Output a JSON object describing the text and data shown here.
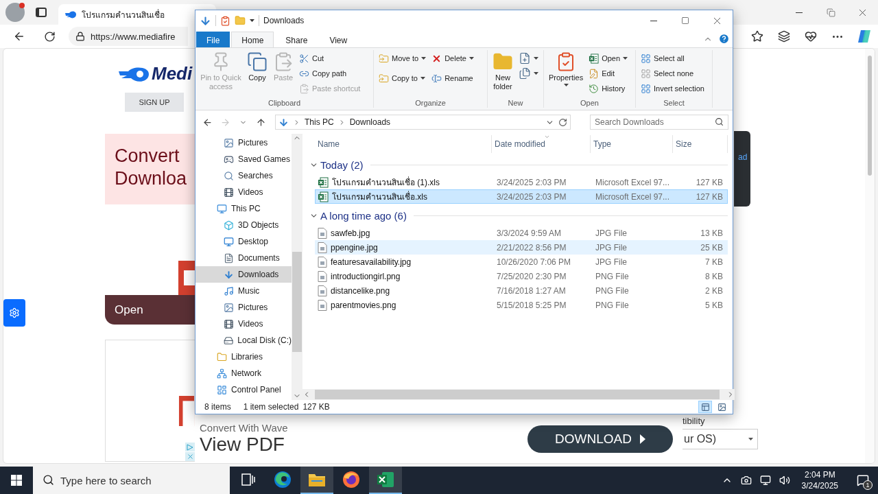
{
  "browser": {
    "tab": {
      "title": "โปรแกรมคำนวนสินเชื่อ",
      "selected": true
    },
    "address": {
      "url": "https://www.mediafire"
    },
    "page": {
      "logo_text": "Medi",
      "signup_button": "SIGN UP",
      "banner_lines": [
        "Convert",
        "Downloa"
      ],
      "open_bar": "Open",
      "right_panel_text": "ad",
      "compat_text": "tibility",
      "os_select": "ur OS)"
    },
    "ad": {
      "tagline": "Convert With Wave",
      "headline": "View PDF",
      "button": "DOWNLOAD"
    }
  },
  "explorer": {
    "title": "Downloads",
    "tabs": [
      {
        "label": "File",
        "kind": "menu",
        "selected": false
      },
      {
        "label": "Home",
        "kind": "tab",
        "selected": true
      },
      {
        "label": "Share",
        "kind": "tab",
        "selected": false
      },
      {
        "label": "View",
        "kind": "tab",
        "selected": false
      }
    ],
    "ribbon": {
      "groups": [
        {
          "kind": "clipboard",
          "label": "Clipboard",
          "commands": [
            {
              "kind": "pin",
              "label": "Pin to Quick access",
              "disabled": true
            },
            {
              "kind": "copy",
              "label": "Copy",
              "disabled": false
            },
            {
              "kind": "paste",
              "label": "Paste",
              "disabled": true
            },
            {
              "kind": "cut",
              "label": "Cut",
              "disabled": false
            },
            {
              "kind": "copy_path",
              "label": "Copy path",
              "disabled": false
            },
            {
              "kind": "paste_shortcut",
              "label": "Paste shortcut",
              "disabled": true
            }
          ]
        },
        {
          "kind": "organize",
          "label": "Organize",
          "commands": [
            {
              "kind": "move_to",
              "label": "Move to",
              "disabled": false
            },
            {
              "kind": "copy_to",
              "label": "Copy to",
              "disabled": false
            },
            {
              "kind": "delete",
              "label": "Delete",
              "disabled": false
            },
            {
              "kind": "rename",
              "label": "Rename",
              "disabled": false
            }
          ]
        },
        {
          "kind": "new",
          "label": "New",
          "commands": [
            {
              "kind": "new_folder",
              "label": "New folder",
              "disabled": false
            },
            {
              "kind": "new_item",
              "disabled": false
            },
            {
              "kind": "easy_access",
              "disabled": false
            }
          ]
        },
        {
          "kind": "open",
          "label": "Open",
          "commands": [
            {
              "kind": "properties",
              "label": "Properties",
              "disabled": false
            },
            {
              "kind": "open",
              "label": "Open",
              "disabled": false
            },
            {
              "kind": "edit",
              "label": "Edit",
              "disabled": false
            },
            {
              "kind": "history",
              "label": "History",
              "disabled": false
            }
          ]
        },
        {
          "kind": "select",
          "label": "Select",
          "commands": [
            {
              "kind": "select_all",
              "label": "Select all",
              "disabled": false
            },
            {
              "kind": "select_none",
              "label": "Select none",
              "disabled": false
            },
            {
              "kind": "invert_selection",
              "label": "Invert selection",
              "disabled": false
            }
          ]
        }
      ]
    },
    "nav_buttons": {
      "back": {
        "disabled": false
      },
      "forward": {
        "disabled": true
      }
    },
    "address": {
      "crumbs": [
        "This PC",
        "Downloads"
      ]
    },
    "search": {
      "placeholder": "Search Downloads"
    },
    "nav_pane": {
      "continued_items": [
        {
          "label": "Pictures",
          "kind": "pictures",
          "selected": false
        },
        {
          "label": "Saved Games",
          "kind": "games",
          "selected": false
        },
        {
          "label": "Searches",
          "kind": "searches",
          "selected": false
        },
        {
          "label": "Videos",
          "kind": "videos",
          "selected": false
        }
      ],
      "items": [
        {
          "label": "This PC",
          "kind": "pc",
          "selected": false,
          "children": [
            {
              "label": "3D Objects",
              "kind": "objects",
              "selected": false
            },
            {
              "label": "Desktop",
              "kind": "desktop",
              "selected": false
            },
            {
              "label": "Documents",
              "kind": "documents",
              "selected": false
            },
            {
              "label": "Downloads",
              "kind": "downloads",
              "selected": true
            },
            {
              "label": "Music",
              "kind": "music",
              "selected": false
            },
            {
              "label": "Pictures",
              "kind": "pictures",
              "selected": false
            },
            {
              "label": "Videos",
              "kind": "videos",
              "selected": false
            },
            {
              "label": "Local Disk (C:)",
              "kind": "disk",
              "selected": false
            }
          ]
        },
        {
          "label": "Libraries",
          "kind": "libraries",
          "selected": false
        },
        {
          "label": "Network",
          "kind": "network",
          "selected": false
        },
        {
          "label": "Control Panel",
          "kind": "control",
          "selected": false
        }
      ]
    },
    "columns": [
      {
        "label": "Name",
        "sorted": false
      },
      {
        "label": "Date modified",
        "sorted": true
      },
      {
        "label": "Type",
        "sorted": false
      },
      {
        "label": "Size",
        "sorted": false
      }
    ],
    "groups": [
      {
        "label": "Today (2)",
        "expanded": true,
        "files": [
          {
            "name": "โปรแกรมคำนวนสินเชื่อ (1).xls",
            "date": "3/24/2025 2:03 PM",
            "type": "Microsoft Excel 97...",
            "size": "127 KB",
            "kind": "excel",
            "selected": false,
            "hovered": false
          },
          {
            "name": "โปรแกรมคำนวนสินเชื่อ.xls",
            "date": "3/24/2025 2:03 PM",
            "type": "Microsoft Excel 97...",
            "size": "127 KB",
            "kind": "excel",
            "selected": true,
            "hovered": false
          }
        ]
      },
      {
        "label": "A long time ago (6)",
        "expanded": true,
        "files": [
          {
            "name": "sawfeb.jpg",
            "date": "3/3/2024 9:59 AM",
            "type": "JPG File",
            "size": "13 KB",
            "kind": "image",
            "selected": false,
            "hovered": false
          },
          {
            "name": "ppengine.jpg",
            "date": "2/21/2022 8:56 PM",
            "type": "JPG File",
            "size": "25 KB",
            "kind": "image",
            "selected": false,
            "hovered": true
          },
          {
            "name": "featuresavailability.jpg",
            "date": "10/26/2020 7:06 PM",
            "type": "JPG File",
            "size": "7 KB",
            "kind": "image",
            "selected": false,
            "hovered": false
          },
          {
            "name": "introductiongirl.png",
            "date": "7/25/2020 2:30 PM",
            "type": "PNG File",
            "size": "8 KB",
            "kind": "image",
            "selected": false,
            "hovered": false
          },
          {
            "name": "distancelike.png",
            "date": "7/16/2018 1:27 AM",
            "type": "PNG File",
            "size": "2 KB",
            "kind": "image",
            "selected": false,
            "hovered": false
          },
          {
            "name": "parentmovies.png",
            "date": "5/15/2018 5:25 PM",
            "type": "PNG File",
            "size": "5 KB",
            "kind": "image",
            "selected": false,
            "hovered": false
          }
        ]
      }
    ],
    "status": {
      "count": "8 items",
      "selection": "1 item selected",
      "size": "127 KB"
    },
    "view_modes": [
      {
        "kind": "details",
        "selected": true
      },
      {
        "kind": "thumbnails",
        "selected": false
      }
    ]
  },
  "taskbar": {
    "search": {
      "placeholder": "Type here to search"
    },
    "apps": [
      {
        "kind": "taskview",
        "active": false
      },
      {
        "kind": "edge",
        "active": false
      },
      {
        "kind": "explorer",
        "active": true
      },
      {
        "kind": "firefox",
        "active": false
      },
      {
        "kind": "excel",
        "active": true
      }
    ],
    "time": "2:04 PM",
    "date": "3/24/2025",
    "notification_count": "1"
  }
}
